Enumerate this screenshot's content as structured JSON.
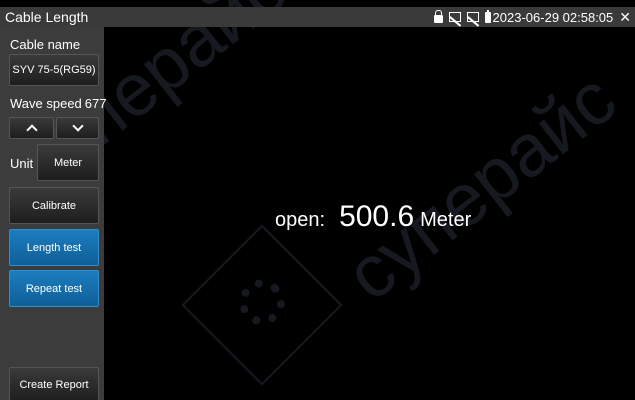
{
  "titlebar": {
    "title": "Cable Length",
    "datetime": "2023-06-29 02:58:05"
  },
  "sidebar": {
    "cable_name_label": "Cable name",
    "cable_name_value": "SYV 75-5(RG59)",
    "wave_speed_label": "Wave speed",
    "wave_speed_value": "677",
    "unit_label": "Unit",
    "unit_value": "Meter",
    "calibrate_label": "Calibrate",
    "length_test_label": "Length test",
    "repeat_test_label": "Repeat test",
    "create_report_label": "Create Report"
  },
  "reading": {
    "state": "open:",
    "value": "500.6",
    "unit": "Meter"
  },
  "watermark": {
    "text": "суперайс"
  },
  "colors": {
    "accent_blue": "#1c7dbf",
    "sidebar_bg": "#3c3c3c",
    "titlebar_bg": "#3a3a3a",
    "screen_bg": "#000000"
  },
  "icons": [
    "lock-icon",
    "monitor-icon",
    "battery-icon",
    "close-icon",
    "arrow-up-icon",
    "arrow-down-icon"
  ]
}
